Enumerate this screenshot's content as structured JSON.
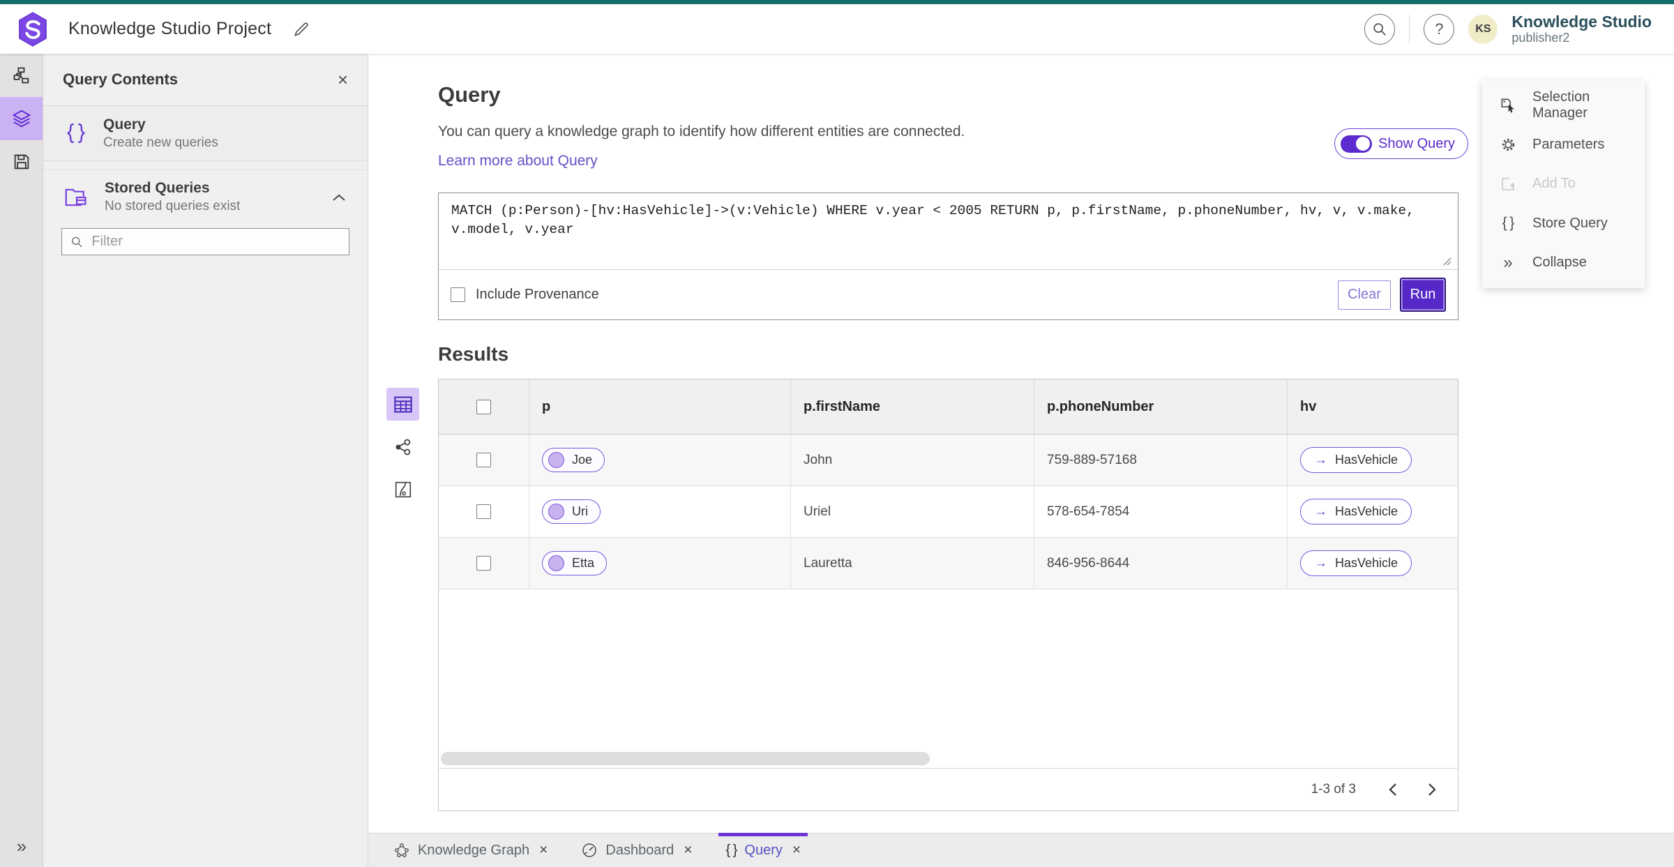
{
  "topbar": {
    "title": "Knowledge Studio Project",
    "product": "Knowledge Studio",
    "user": "publisher2",
    "avatar_initials": "KS"
  },
  "icons": {
    "close": "×",
    "help": "?",
    "collapse_double_arrow": "»",
    "relationship_arrow": "→",
    "braces": "{ }"
  },
  "left_panel": {
    "title": "Query Contents",
    "items": [
      {
        "label": "Query",
        "description": "Create new queries"
      },
      {
        "label": "Stored Queries",
        "description": "No stored queries exist"
      }
    ],
    "filter_placeholder": "Filter"
  },
  "query": {
    "heading": "Query",
    "description": "You can query a knowledge graph to identify how different entities are connected.",
    "link": "Learn more about Query",
    "toggle_label": "Show Query",
    "text": "MATCH (p:Person)-[hv:HasVehicle]->(v:Vehicle) WHERE v.year < 2005 RETURN p, p.firstName, p.phoneNumber, hv, v, v.make, v.model, v.year",
    "provenance_label": "Include Provenance",
    "clear_label": "Clear",
    "run_label": "Run"
  },
  "results": {
    "heading": "Results",
    "columns": [
      "p",
      "p.firstName",
      "p.phoneNumber",
      "hv"
    ],
    "rows": [
      {
        "p": "Joe",
        "firstName": "John",
        "phone": "759-889-57168",
        "hv": "HasVehicle"
      },
      {
        "p": "Uri",
        "firstName": "Uriel",
        "phone": "578-654-7854",
        "hv": "HasVehicle"
      },
      {
        "p": "Etta",
        "firstName": "Lauretta",
        "phone": "846-956-8644",
        "hv": "HasVehicle"
      }
    ],
    "pagination": "1-3 of 3"
  },
  "right_panel": {
    "items": [
      {
        "label": "Selection Manager"
      },
      {
        "label": "Parameters"
      },
      {
        "label": "Add To"
      },
      {
        "label": "Store Query"
      },
      {
        "label": "Collapse"
      }
    ]
  },
  "tabs": [
    {
      "label": "Knowledge Graph"
    },
    {
      "label": "Dashboard"
    },
    {
      "label": "Query"
    }
  ],
  "colors": {
    "accent_purple": "#5b2bd0",
    "light_purple": "#cbb2f3",
    "top_strip_teal": "#15706b",
    "avatar_yellow": "#f0ecc8"
  }
}
